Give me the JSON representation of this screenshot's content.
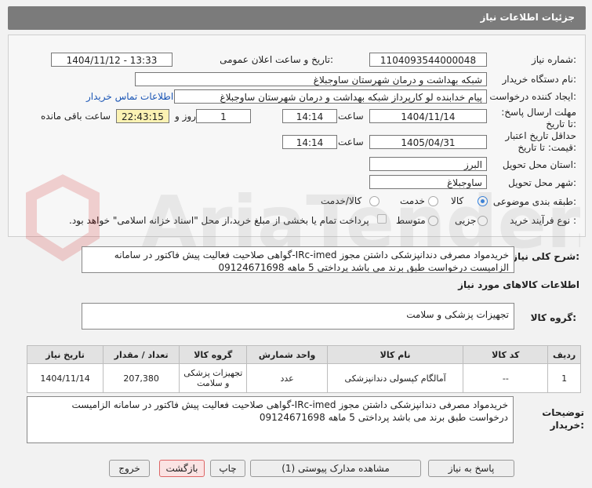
{
  "header": {
    "title": "جزئیات اطلاعات نیاز"
  },
  "form": {
    "need_number_label": "شماره نیاز:",
    "need_number": "1104093544000048",
    "announce_label": "تاریخ و ساعت اعلان عمومی:",
    "announce_value": "1404/11/12 - 13:33",
    "buyer_org_label": "نام دستگاه خریدار:",
    "buyer_org": "شبکه بهداشت و درمان شهرستان ساوجبلاغ",
    "creator_label": "ایجاد کننده درخواست:",
    "creator": "پیام خدابنده لو کارپرداز شبکه بهداشت و درمان شهرستان ساوجبلاغ",
    "contact_link": "اطلاعات تماس خریدار",
    "reply_deadline_label": "مهلت ارسال پاسخ: تا تاریخ:",
    "reply_date": "1404/11/14",
    "time_label": "ساعت",
    "reply_time": "14:14",
    "days_value": "1",
    "days_label": "روز و",
    "remaining_time": "22:43:15",
    "remaining_label": "ساعت باقی مانده",
    "validity_label": "حداقل تاریخ اعتبار قیمت: تا تاریخ:",
    "validity_date": "1405/04/31",
    "validity_time": "14:14",
    "province_label": "استان محل تحویل:",
    "province": "البرز",
    "city_label": "شهر محل تحویل:",
    "city": "ساوجبلاغ",
    "category_label": "طبقه بندی موضوعی:",
    "category_options": [
      "کالا",
      "خدمت",
      "کالا/خدمت"
    ],
    "process_label": "نوع فرآیند خرید :",
    "process_options": [
      "جزیی",
      "متوسط"
    ],
    "process_note": "پرداخت تمام یا بخشی از مبلغ خرید،از محل \"اسناد خزانه اسلامی\" خواهد بود."
  },
  "summary": {
    "label": "شرح کلی نیاز:",
    "text": "خریدمواد مصرفی دندانپزشکی داشتن مجوز IRc-imed-گواهی صلاحیت فعالیت پیش فاکتور در سامانه الزامیست درخواست طبق برند می باشد پرداختی 5 ماهه 09124671698"
  },
  "goods_info_title": "اطلاعات کالاهای مورد نیاز",
  "goods_group_label": "گروه کالا:",
  "goods_group": "تجهیزات پزشکی و سلامت",
  "table": {
    "headers": [
      "ردیف",
      "کد کالا",
      "نام کالا",
      "واحد شمارش",
      "گروه کالا",
      "تعداد / مقدار",
      "تاریخ نیاز"
    ],
    "rows": [
      [
        "1",
        "--",
        "آمالگام کپسولی دندانپزشکی",
        "عدد",
        "تجهیزات پزشکی و سلامت",
        "207,380",
        "1404/11/14"
      ]
    ]
  },
  "buyer_notes_label": "توضیحات خریدار:",
  "buyer_notes": "خریدمواد مصرفی دندانپزشکی داشتن مجوز IRc-imed-گواهی صلاحیت فعالیت پیش فاکتور در سامانه الزامیست درخواست طبق برند می باشد پرداختی 5 ماهه 09124671698",
  "buttons": {
    "reply": "پاسخ به نیاز",
    "attachments": "مشاهده مدارک پیوستی (1)",
    "print": "چاپ",
    "back": "بازگشت",
    "exit": "خروج"
  },
  "watermark_text": "AriaTender.net"
}
